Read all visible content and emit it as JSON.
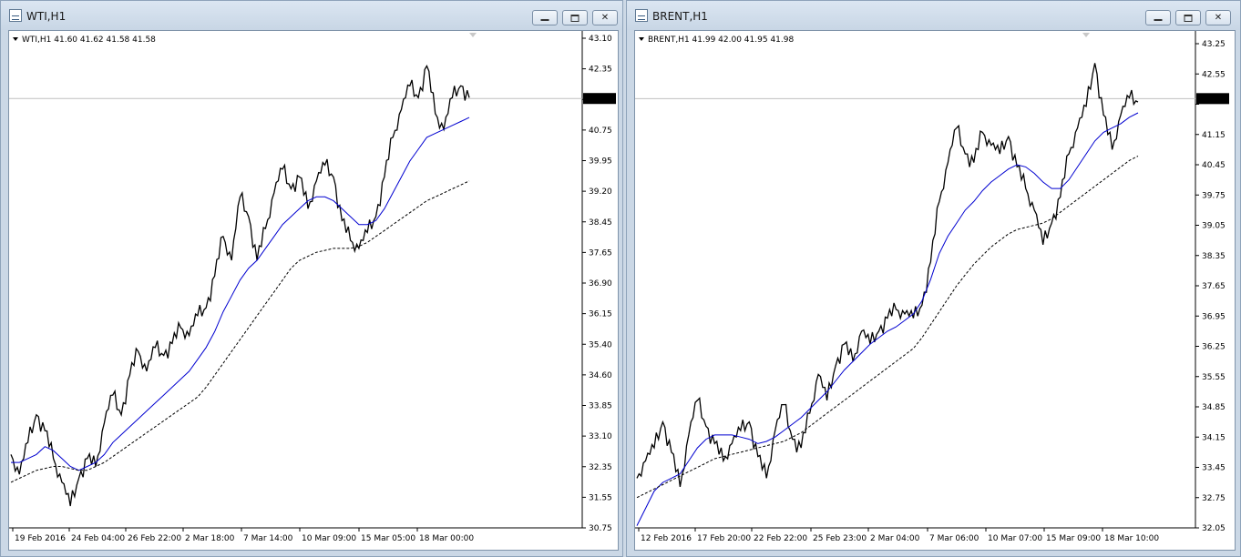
{
  "colors": {
    "price": "#000000",
    "ma_fast": "#0000d0",
    "ma_slow": "#000000",
    "price_line": "#c0c0c0",
    "price_label_bg": "#000000",
    "background": "#ffffff"
  },
  "windows": [
    {
      "title": "WTI,H1",
      "icons": {
        "app": "chart-window-icon",
        "minimize": "minimize-icon",
        "maximize": "maximize-icon",
        "close": "close-icon"
      },
      "header": "WTI,H1  41.60 41.62 41.58 41.58",
      "current_price": "41.58",
      "y_ticks": [
        "43.10",
        "42.35",
        "41.58",
        "40.75",
        "39.95",
        "39.20",
        "38.45",
        "37.65",
        "36.90",
        "36.15",
        "35.40",
        "34.60",
        "33.85",
        "33.10",
        "32.35",
        "31.55",
        "30.75"
      ],
      "x_ticks": [
        "19 Feb 2016",
        "24 Feb 04:00",
        "26 Feb 22:00",
        "2 Mar 18:00",
        "7 Mar 14:00",
        "10 Mar 09:00",
        "15 Mar 05:00",
        "18 Mar 00:00"
      ]
    },
    {
      "title": "BRENT,H1",
      "icons": {
        "app": "chart-window-icon",
        "minimize": "minimize-icon",
        "maximize": "maximize-icon",
        "close": "close-icon"
      },
      "header": "BRENT,H1  41.99 42.00 41.95 41.98",
      "current_price": "41.98",
      "y_ticks": [
        "43.25",
        "42.55",
        "41.98",
        "41.15",
        "40.45",
        "39.75",
        "39.05",
        "38.35",
        "37.65",
        "36.95",
        "36.25",
        "35.55",
        "34.85",
        "34.15",
        "33.45",
        "32.75",
        "32.05"
      ],
      "x_ticks": [
        "12 Feb 2016",
        "17 Feb 20:00",
        "22 Feb 22:00",
        "25 Feb 23:00",
        "2 Mar 04:00",
        "7 Mar 06:00",
        "10 Mar 07:00",
        "15 Mar 09:00",
        "18 Mar 10:00"
      ]
    }
  ],
  "chart_data": [
    {
      "type": "line",
      "title": "WTI,H1",
      "ylim": [
        30.75,
        43.1
      ],
      "series": [
        {
          "name": "",
          "style": "price",
          "values": [
            32.6,
            32.1,
            32.9,
            33.6,
            33.2,
            32.5,
            31.9,
            31.3,
            32.0,
            32.5,
            32.3,
            33.4,
            34.1,
            33.6,
            34.6,
            35.2,
            34.7,
            35.3,
            35.1,
            35.4,
            35.8,
            35.6,
            36.1,
            36.3,
            37.1,
            38.1,
            37.5,
            39.1,
            38.6,
            37.5,
            38.3,
            39.2,
            39.8,
            39.3,
            39.6,
            38.8,
            39.5,
            39.9,
            39.6,
            38.5,
            38.0,
            37.8,
            38.2,
            38.6,
            39.6,
            40.6,
            41.3,
            41.9,
            41.6,
            42.4,
            41.2,
            40.8,
            41.6,
            41.9,
            41.6
          ]
        },
        {
          "name": "",
          "style": "ma_fast",
          "values": [
            32.4,
            32.4,
            32.5,
            32.6,
            32.8,
            32.7,
            32.5,
            32.3,
            32.2,
            32.3,
            32.4,
            32.6,
            32.9,
            33.1,
            33.3,
            33.5,
            33.7,
            33.9,
            34.1,
            34.3,
            34.5,
            34.7,
            35.0,
            35.3,
            35.7,
            36.2,
            36.6,
            37.0,
            37.3,
            37.5,
            37.8,
            38.1,
            38.4,
            38.6,
            38.8,
            39.0,
            39.1,
            39.1,
            39.0,
            38.8,
            38.6,
            38.4,
            38.4,
            38.5,
            38.8,
            39.2,
            39.6,
            40.0,
            40.3,
            40.6,
            40.7,
            40.8,
            40.9,
            41.0,
            41.1
          ]
        },
        {
          "name": "",
          "style": "ma_slow",
          "values": [
            31.9,
            32.0,
            32.1,
            32.2,
            32.25,
            32.3,
            32.3,
            32.25,
            32.2,
            32.2,
            32.3,
            32.4,
            32.55,
            32.7,
            32.85,
            33.0,
            33.15,
            33.3,
            33.45,
            33.6,
            33.75,
            33.9,
            34.05,
            34.3,
            34.6,
            34.9,
            35.2,
            35.5,
            35.8,
            36.1,
            36.4,
            36.7,
            37.0,
            37.3,
            37.5,
            37.6,
            37.7,
            37.75,
            37.8,
            37.8,
            37.8,
            37.85,
            37.95,
            38.1,
            38.25,
            38.4,
            38.55,
            38.7,
            38.85,
            39.0,
            39.1,
            39.2,
            39.3,
            39.4,
            39.5
          ]
        }
      ]
    },
    {
      "type": "line",
      "title": "BRENT,H1",
      "ylim": [
        32.05,
        43.25
      ],
      "series": [
        {
          "name": "",
          "style": "price",
          "values": [
            33.2,
            33.6,
            33.9,
            34.5,
            33.8,
            33.0,
            34.2,
            35.0,
            34.4,
            34.0,
            33.6,
            34.0,
            34.3,
            34.5,
            33.7,
            33.2,
            34.3,
            34.9,
            34.1,
            33.9,
            34.7,
            35.6,
            35.0,
            35.8,
            36.3,
            35.9,
            36.6,
            36.3,
            36.6,
            36.9,
            37.1,
            37.0,
            36.9,
            37.2,
            38.2,
            39.6,
            40.5,
            41.3,
            40.7,
            40.5,
            41.2,
            40.9,
            40.7,
            41.1,
            40.4,
            39.9,
            39.4,
            38.6,
            39.1,
            39.7,
            40.7,
            41.3,
            41.8,
            42.8,
            41.6,
            40.8,
            41.6,
            42.0,
            41.9
          ]
        },
        {
          "name": "",
          "style": "ma_fast",
          "values": [
            32.1,
            32.5,
            32.9,
            33.1,
            33.2,
            33.3,
            33.6,
            33.9,
            34.1,
            34.2,
            34.2,
            34.2,
            34.15,
            34.1,
            34.0,
            34.05,
            34.15,
            34.3,
            34.45,
            34.6,
            34.8,
            35.0,
            35.2,
            35.45,
            35.7,
            35.9,
            36.1,
            36.3,
            36.45,
            36.6,
            36.7,
            36.85,
            37.0,
            37.3,
            37.8,
            38.4,
            38.8,
            39.1,
            39.4,
            39.6,
            39.85,
            40.05,
            40.2,
            40.35,
            40.45,
            40.4,
            40.25,
            40.05,
            39.9,
            39.9,
            40.1,
            40.4,
            40.7,
            41.0,
            41.2,
            41.3,
            41.4,
            41.55,
            41.65
          ]
        },
        {
          "name": "",
          "style": "ma_slow",
          "values": [
            32.75,
            32.85,
            32.95,
            33.05,
            33.15,
            33.25,
            33.35,
            33.45,
            33.55,
            33.65,
            33.7,
            33.75,
            33.8,
            33.85,
            33.9,
            33.95,
            34.0,
            34.05,
            34.15,
            34.25,
            34.4,
            34.55,
            34.7,
            34.85,
            35.0,
            35.15,
            35.3,
            35.45,
            35.6,
            35.75,
            35.9,
            36.05,
            36.2,
            36.45,
            36.75,
            37.05,
            37.35,
            37.65,
            37.9,
            38.15,
            38.35,
            38.55,
            38.7,
            38.85,
            38.95,
            39.0,
            39.05,
            39.1,
            39.2,
            39.35,
            39.5,
            39.65,
            39.8,
            39.95,
            40.1,
            40.25,
            40.4,
            40.55,
            40.65
          ]
        }
      ]
    }
  ]
}
